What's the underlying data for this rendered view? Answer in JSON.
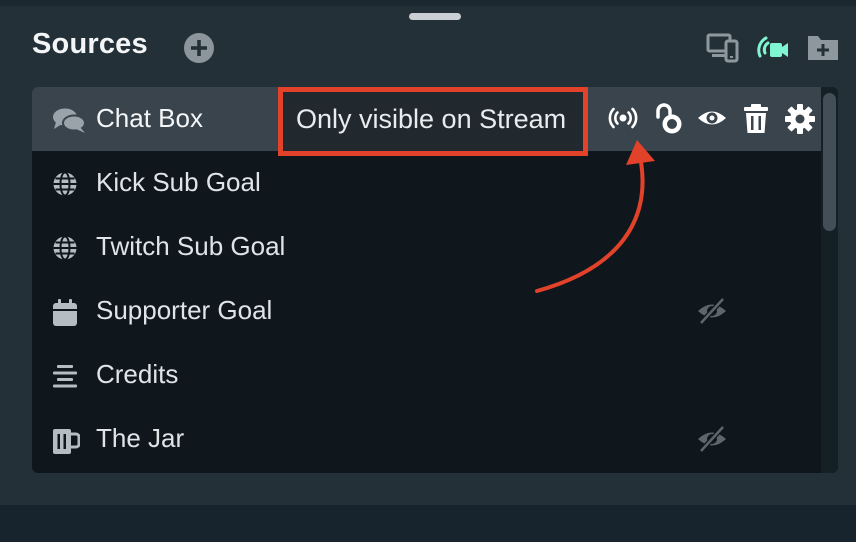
{
  "header": {
    "title": "Sources",
    "icons": [
      "add-source-icon",
      "device-icon",
      "stream-camera-icon",
      "add-folder-icon"
    ],
    "accent": "#80f5d2"
  },
  "sources": [
    {
      "label": "Chat Box",
      "icon": "chat-icon",
      "selected": true,
      "hidden": false
    },
    {
      "label": "Kick Sub Goal",
      "icon": "globe-icon",
      "selected": false,
      "hidden": false
    },
    {
      "label": "Twitch Sub Goal",
      "icon": "globe-icon",
      "selected": false,
      "hidden": false
    },
    {
      "label": "Supporter Goal",
      "icon": "calendar-icon",
      "selected": false,
      "hidden": true
    },
    {
      "label": "Credits",
      "icon": "align-center-icon",
      "selected": false,
      "hidden": false
    },
    {
      "label": "The Jar",
      "icon": "jar-icon",
      "selected": false,
      "hidden": true
    }
  ],
  "row_actions": [
    "broadcast-icon",
    "unlock-icon",
    "eye-icon",
    "trash-icon",
    "gear-icon"
  ],
  "annotation": {
    "text": "Only visible on Stream",
    "color": "#e2412a"
  }
}
